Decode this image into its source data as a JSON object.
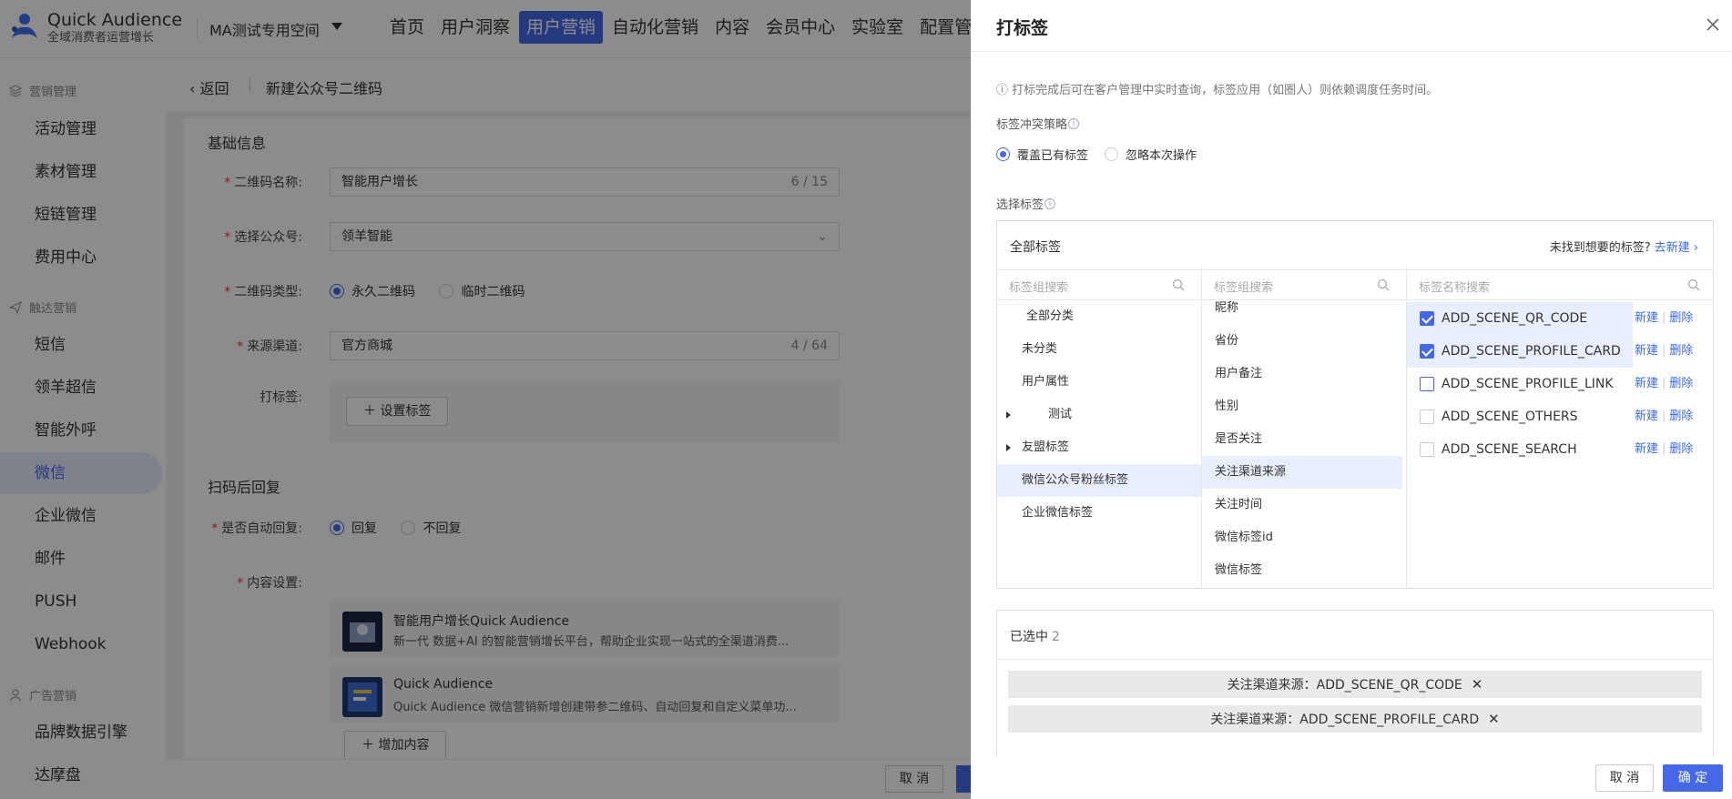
{
  "app": {
    "name": "Quick Audience",
    "subtitle": "全域消费者运营增长"
  },
  "workspace": {
    "label": "MA测试专用空间"
  },
  "nav": [
    {
      "label": "首页"
    },
    {
      "label": "用户洞察"
    },
    {
      "label": "用户营销",
      "active": true
    },
    {
      "label": "自动化营销"
    },
    {
      "label": "内容"
    },
    {
      "label": "会员中心"
    },
    {
      "label": "实验室"
    },
    {
      "label": "配置管理"
    }
  ],
  "sidebar": {
    "groups": [
      {
        "label": "营销管理",
        "icon": "layers-icon"
      },
      {
        "label": "触达营销",
        "icon": "send-icon"
      },
      {
        "label": "广告营销",
        "icon": "people-icon"
      }
    ],
    "items": [
      {
        "label": "活动管理"
      },
      {
        "label": "素材管理"
      },
      {
        "label": "短链管理"
      },
      {
        "label": "费用中心"
      },
      {
        "label": "短信"
      },
      {
        "label": "领羊超信"
      },
      {
        "label": "智能外呼"
      },
      {
        "label": "微信",
        "active": true
      },
      {
        "label": "企业微信"
      },
      {
        "label": "邮件"
      },
      {
        "label": "PUSH"
      },
      {
        "label": "Webhook"
      },
      {
        "label": "品牌数据引擎"
      },
      {
        "label": "达摩盘"
      }
    ]
  },
  "page": {
    "back": "返回",
    "title": "新建公众号二维码",
    "basic_section": "基础信息",
    "reply_section": "扫码后回复",
    "fields": {
      "qr_name": {
        "label": "二维码名称:",
        "value": "智能用户增长",
        "count": "6 / 15"
      },
      "account": {
        "label": "选择公众号:",
        "value": "领羊智能"
      },
      "qr_type": {
        "label": "二维码类型:",
        "options": [
          "永久二维码",
          "临时二维码"
        ],
        "selected": "永久二维码"
      },
      "channel": {
        "label": "来源渠道:",
        "value": "官方商城",
        "count": "4 / 64"
      },
      "tags": {
        "label": "打标签:",
        "button": "设置标签"
      },
      "auto_reply": {
        "label": "是否自动回复:",
        "options": [
          "回复",
          "不回复"
        ],
        "selected": "回复"
      },
      "content": {
        "label": "内容设置:",
        "add_button": "增加内容"
      }
    },
    "contents": [
      {
        "title": "智能用户增长Quick Audience",
        "desc": "新一代 数据+AI 的智能营销增长平台，帮助企业实现一站式的全渠道消费..."
      },
      {
        "title": "Quick Audience",
        "desc": "Quick Audience 微信营销新增创建带参二维码、自动回复和自定义菜单功..."
      }
    ],
    "footer_cancel": "取 消"
  },
  "drawer": {
    "title": "打标签",
    "note": "ⓘ 打标完成后可在客户管理中实时查询，标签应用（如圈人）则依赖调度任务时间。",
    "conflict_label": "标签冲突策略",
    "conflict_options": [
      "覆盖已有标签",
      "忽略本次操作"
    ],
    "conflict_selected": "覆盖已有标签",
    "select_label": "选择标签",
    "all_tags": "全部标签",
    "not_found": "未找到想要的标签?",
    "go_create": "去新建",
    "search1": "标签组搜索",
    "search2": "标签组搜索",
    "search3": "标签名称搜索",
    "groups": [
      {
        "label": "全部分类",
        "indent": 1
      },
      {
        "label": "未分类",
        "indent": 0
      },
      {
        "label": "用户属性",
        "indent": 0
      },
      {
        "label": "测试",
        "indent": 2,
        "expandable": true
      },
      {
        "label": "友盟标签",
        "indent": 0,
        "expandable": true
      },
      {
        "label": "微信公众号粉丝标签",
        "indent": 0,
        "selected": true
      },
      {
        "label": "企业微信标签",
        "indent": 0
      }
    ],
    "subgroups": [
      {
        "label": "昵称"
      },
      {
        "label": "省份"
      },
      {
        "label": "用户备注"
      },
      {
        "label": "性别"
      },
      {
        "label": "是否关注"
      },
      {
        "label": "关注渠道来源",
        "selected": true
      },
      {
        "label": "关注时间"
      },
      {
        "label": "微信标签id"
      },
      {
        "label": "微信标签"
      }
    ],
    "tags": [
      {
        "label": "ADD_SCENE_QR_CODE",
        "checked": true
      },
      {
        "label": "ADD_SCENE_PROFILE_CARD",
        "checked": true
      },
      {
        "label": "ADD_SCENE_PROFILE_LINK",
        "checked": false,
        "hover": true
      },
      {
        "label": "ADD_SCENE_OTHERS",
        "checked": false
      },
      {
        "label": "ADD_SCENE_SEARCH",
        "checked": false
      }
    ],
    "tag_new": "新建",
    "tag_delete": "删除",
    "selected_label": "已选中",
    "selected_count": "2",
    "selected_chips": [
      "关注渠道来源：ADD_SCENE_QR_CODE",
      "关注渠道来源：ADD_SCENE_PROFILE_CARD"
    ],
    "cancel": "取 消",
    "ok": "确 定"
  },
  "colors": {
    "accent": "#4468e8",
    "link": "#3a6ae8",
    "mask": "rgba(0,0,0,0.45)"
  }
}
